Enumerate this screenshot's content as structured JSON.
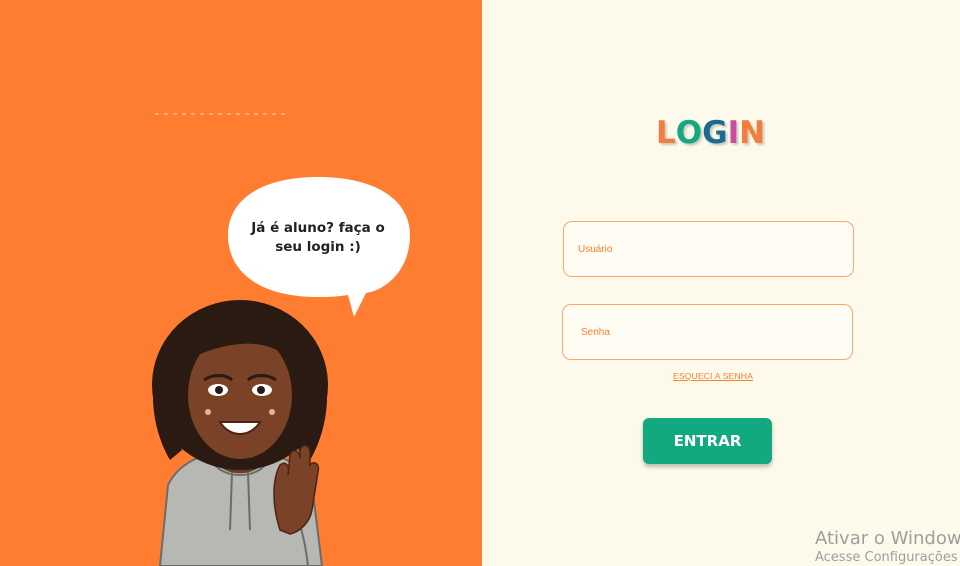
{
  "left": {
    "speech_bubble": "Já é aluno? faça o seu login :)"
  },
  "login": {
    "title_letters": [
      {
        "char": "L",
        "color": "#f47c3c"
      },
      {
        "char": "O",
        "color": "#13a980"
      },
      {
        "char": "G",
        "color": "#1b6b8f"
      },
      {
        "char": "I",
        "color": "#c94f9a"
      },
      {
        "char": "N",
        "color": "#f47c3c"
      }
    ],
    "username_placeholder": "Usuário",
    "password_placeholder": "Senha",
    "forgot_link": "ESQUECI A SENHA",
    "submit_label": "ENTRAR"
  },
  "colors": {
    "left_background": "#ff7d30",
    "right_background": "#fdfaeb",
    "button": "#13a980",
    "accent": "#ff7d30"
  },
  "watermark": {
    "line1": "Ativar o Windows",
    "line2": "Acesse Configurações"
  }
}
